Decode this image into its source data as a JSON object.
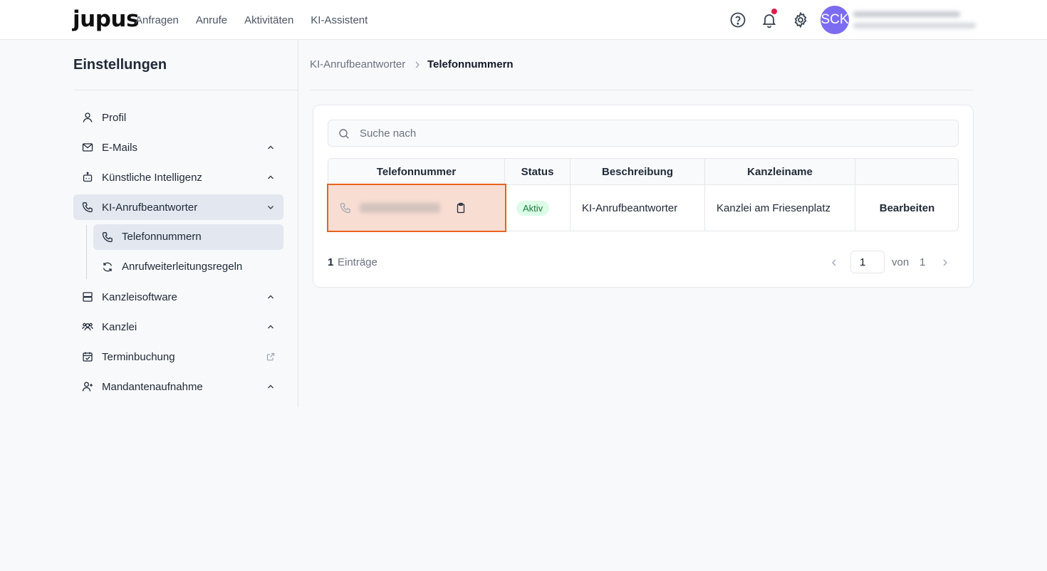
{
  "header": {
    "logo": "jupus",
    "nav": [
      "Anfragen",
      "Anrufe",
      "Aktivitäten",
      "KI-Assistent"
    ],
    "avatar_initials": "SCK",
    "icons": [
      "help-icon",
      "bell-icon",
      "gear-icon"
    ],
    "notification_dot_color": "#e11d48"
  },
  "sidebar": {
    "title": "Einstellungen",
    "items": [
      {
        "label": "Profil",
        "icon": "user-icon"
      },
      {
        "label": "E-Mails",
        "icon": "mail-icon"
      },
      {
        "label": "Künstliche Intelligenz",
        "icon": "bot-icon"
      },
      {
        "label": "KI-Anrufbeantworter",
        "icon": "phone-icon"
      },
      {
        "label": "Kanzleisoftware",
        "icon": "server-icon"
      },
      {
        "label": "Kanzlei",
        "icon": "users-icon"
      },
      {
        "label": "Terminbuchung",
        "icon": "calendar-check-icon"
      },
      {
        "label": "Mandantenaufnahme",
        "icon": "user-plus-icon"
      }
    ],
    "subitems": [
      {
        "label": "Telefonnummern",
        "icon": "phone-icon"
      },
      {
        "label": "Anrufweiterleitungsregeln",
        "icon": "refresh-icon"
      }
    ]
  },
  "breadcrumb": {
    "parent": "KI-Anrufbeantworter",
    "current": "Telefonnummern"
  },
  "search": {
    "placeholder": "Suche nach"
  },
  "table": {
    "headers": [
      "Telefonnummer",
      "Status",
      "Beschreibung",
      "Kanzleiname",
      ""
    ],
    "rows": [
      {
        "status": "Aktiv",
        "description": "KI-Anrufbeantworter",
        "firm": "Kanzlei am Friesenplatz",
        "action": "Bearbeiten"
      }
    ]
  },
  "pagination": {
    "count": "1",
    "count_label": "Einträge",
    "current_page": "1",
    "of_label": "von",
    "total_pages": "1"
  },
  "colors": {
    "accent_avatar": "#7c6cf2",
    "highlight_border": "#e8631c",
    "status_badge_bg": "#dcfce7",
    "status_badge_text": "#15803d"
  }
}
